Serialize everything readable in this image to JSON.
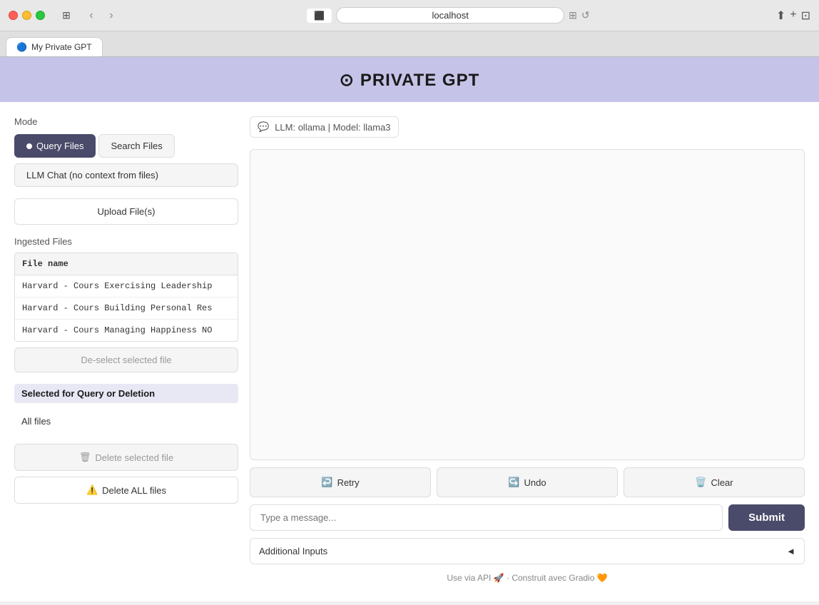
{
  "browser": {
    "address": "localhost",
    "tab_label": "My Private GPT",
    "tab_icon": "🔵"
  },
  "header": {
    "title": "PRIVATE GPT",
    "github_icon": "⊙"
  },
  "llm_info": {
    "icon": "💬",
    "text": "LLM: ollama | Model: llama3"
  },
  "mode": {
    "label": "Mode",
    "query_files_label": "Query Files",
    "search_files_label": "Search Files",
    "llm_chat_label": "LLM Chat (no context from files)"
  },
  "upload": {
    "label": "Upload File(s)"
  },
  "ingested_files": {
    "section_label": "Ingested Files",
    "column_header": "File name",
    "files": [
      "Harvard - Cours Exercising Leadership",
      "Harvard - Cours Building Personal Res",
      "Harvard - Cours Managing Happiness NO"
    ],
    "deselect_label": "De-select selected file"
  },
  "selected_section": {
    "label": "Selected for Query or Deletion",
    "value": "All files"
  },
  "buttons": {
    "delete_selected": "Delete selected file",
    "delete_all": "Delete ALL files",
    "retry": "Retry",
    "undo": "Undo",
    "clear": "Clear",
    "submit": "Submit"
  },
  "input": {
    "placeholder": "Type a message..."
  },
  "additional_inputs": {
    "label": "Additional Inputs",
    "chevron": "◄"
  },
  "footer": {
    "api_text": "Use via API 🚀",
    "separator": "·",
    "built_text": "Construit avec Gradio 🧡"
  },
  "icons": {
    "trash": "🗑",
    "warning": "⚠️",
    "retry": "↩️",
    "undo": "↪️",
    "clear": "🗑️"
  }
}
